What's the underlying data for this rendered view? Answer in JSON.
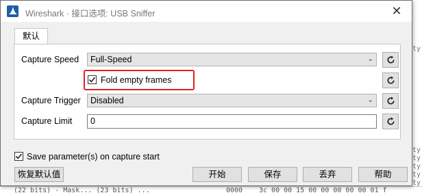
{
  "window": {
    "title": "Wireshark · 接口选项: USB Sniffer"
  },
  "tabs": [
    {
      "label": "默认"
    }
  ],
  "fields": {
    "capture_speed": {
      "label": "Capture Speed",
      "value": "Full-Speed"
    },
    "fold_empty": {
      "label": "Fold empty frames",
      "checked": true
    },
    "capture_trigger": {
      "label": "Capture Trigger",
      "value": "Disabled"
    },
    "capture_limit": {
      "label": "Capture Limit",
      "value": "0"
    }
  },
  "save_params": {
    "label": "Save parameter(s) on capture start",
    "checked": true
  },
  "buttons": {
    "restore_defaults": "恢复默认值",
    "start": "开始",
    "save": "保存",
    "discard": "丢弃",
    "help": "帮助"
  },
  "background": {
    "right_fragments": [
      "ty",
      "ty",
      "ty",
      "ty",
      "ty",
      "ty"
    ],
    "bottom_left": "(22 bits) - Mask...  (23 bits) ...",
    "bottom_mid": "0000",
    "bottom_right": "3c 00 00 15 00 00 00 00 00 01 f"
  },
  "colors": {
    "highlight": "#e02020",
    "titlebar": "#ffffff",
    "dialog_bg": "#f0f0f0"
  },
  "icons": {
    "app": "wireshark-fin-icon",
    "refresh": "refresh-icon",
    "close": "close-icon"
  }
}
